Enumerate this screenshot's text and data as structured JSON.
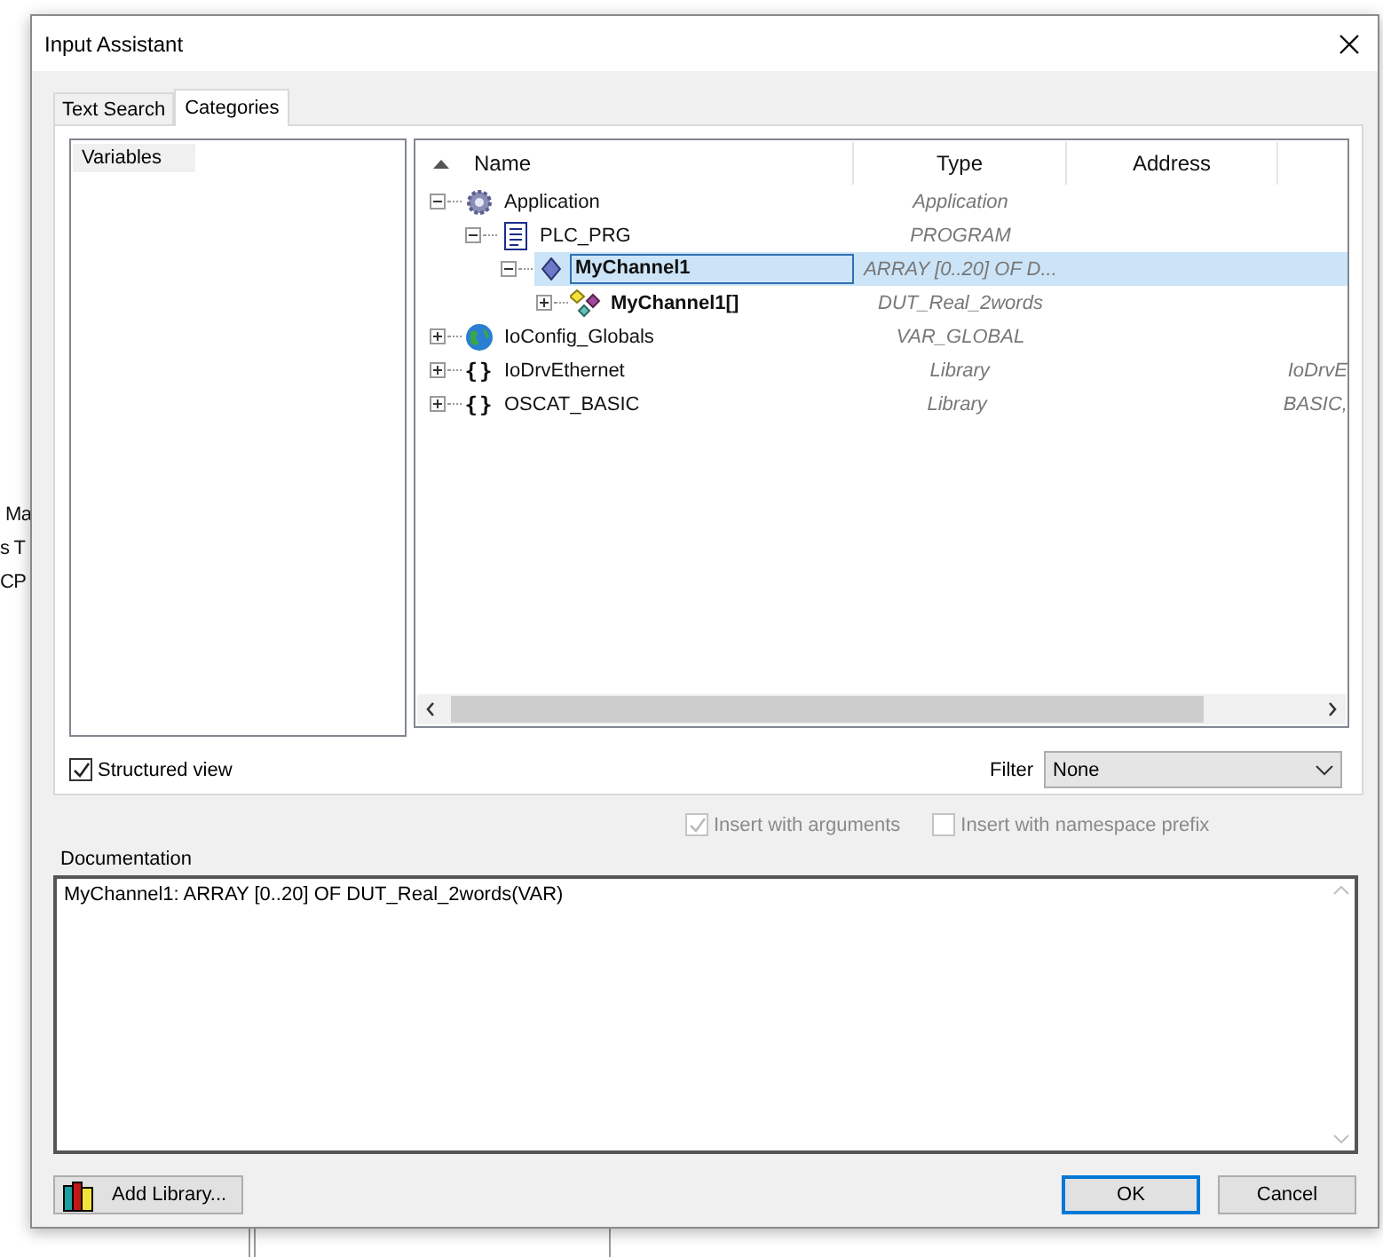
{
  "window": {
    "title": "Input Assistant"
  },
  "background_texts": [
    "Ma",
    "s T",
    "CP"
  ],
  "tabs": [
    {
      "label": "Text Search",
      "selected": false
    },
    {
      "label": "Categories",
      "selected": true
    }
  ],
  "categories": [
    {
      "label": "Variables",
      "selected": true
    }
  ],
  "tree": {
    "columns": [
      "Name",
      "Type",
      "Address"
    ],
    "rows": [
      {
        "name": "Application",
        "type": "Application",
        "kind": "gear",
        "expanded": true,
        "selected": false,
        "bold": false,
        "children": [
          {
            "name": "PLC_PRG",
            "type": "PROGRAM",
            "kind": "document",
            "expanded": true,
            "selected": false,
            "bold": false,
            "children": [
              {
                "name": "MyChannel1",
                "type": "ARRAY [0..20] OF D...",
                "kind": "variable",
                "expanded": true,
                "selected": true,
                "bold": true,
                "children": [
                  {
                    "name": "MyChannel1[]",
                    "type": "DUT_Real_2words",
                    "kind": "struct",
                    "expanded": false,
                    "selected": false,
                    "bold": true
                  }
                ]
              }
            ]
          }
        ]
      },
      {
        "name": "IoConfig_Globals",
        "type": "VAR_GLOBAL",
        "kind": "globe",
        "expanded": false,
        "selected": false,
        "bold": false
      },
      {
        "name": "IoDrvEthernet",
        "type": "Library",
        "column_4": "IoDrvE",
        "kind": "library",
        "glyph": "{}",
        "expanded": false,
        "selected": false,
        "bold": false
      },
      {
        "name": "OSCAT_BASIC",
        "type": "Library",
        "column_4": "BASIC,",
        "kind": "library",
        "glyph": "{}",
        "expanded": false,
        "selected": false,
        "bold": false
      }
    ]
  },
  "structured_view": {
    "label": "Structured view",
    "checked": true
  },
  "filter": {
    "label": "Filter",
    "value": "None"
  },
  "options": [
    {
      "label": "Insert with arguments",
      "checked": true,
      "disabled": true
    },
    {
      "label": "Insert with namespace prefix",
      "checked": false,
      "disabled": true
    }
  ],
  "documentation": {
    "label": "Documentation",
    "value": "MyChannel1: ARRAY [0..20] OF DUT_Real_2words(VAR)"
  },
  "buttons": [
    {
      "kind": "library",
      "label": "Add Library..."
    },
    {
      "kind": "default",
      "label": "OK"
    },
    {
      "kind": "normal",
      "label": "Cancel"
    }
  ]
}
